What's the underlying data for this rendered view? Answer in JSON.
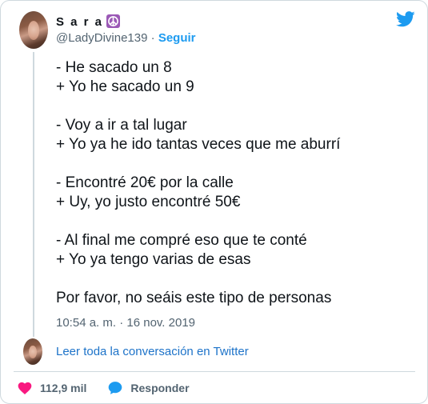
{
  "author": {
    "name": "S a r a",
    "emoji": "peace-symbol-icon",
    "handle": "@LadyDivine139",
    "separator": "·",
    "follow_label": "Seguir"
  },
  "tweet": {
    "lines": [
      "- He sacado un 8",
      "+ Yo he sacado un 9",
      "",
      "- Voy a ir a tal lugar",
      "+ Yo ya he ido tantas veces que me aburrí",
      "",
      "- Encontré 20€ por la calle",
      "+ Uy, yo justo encontré 50€",
      "",
      "- Al final me compré eso que te conté",
      "+ Yo ya tengo varias de esas",
      "",
      "Por favor, no seáis este tipo de personas"
    ],
    "timestamp": "10:54 a. m. · 16 nov. 2019"
  },
  "thread": {
    "read_more": "Leer toda la conversación en Twitter"
  },
  "actions": {
    "likes": "112,9 mil",
    "reply_label": "Responder"
  },
  "colors": {
    "accent": "#1d9bf0",
    "like": "#f91880",
    "text": "#0f1419",
    "muted": "#536471",
    "link": "#1d73c9"
  },
  "icons": {
    "brand": "twitter-bird-icon",
    "like": "heart-icon",
    "reply": "speech-bubble-icon"
  }
}
